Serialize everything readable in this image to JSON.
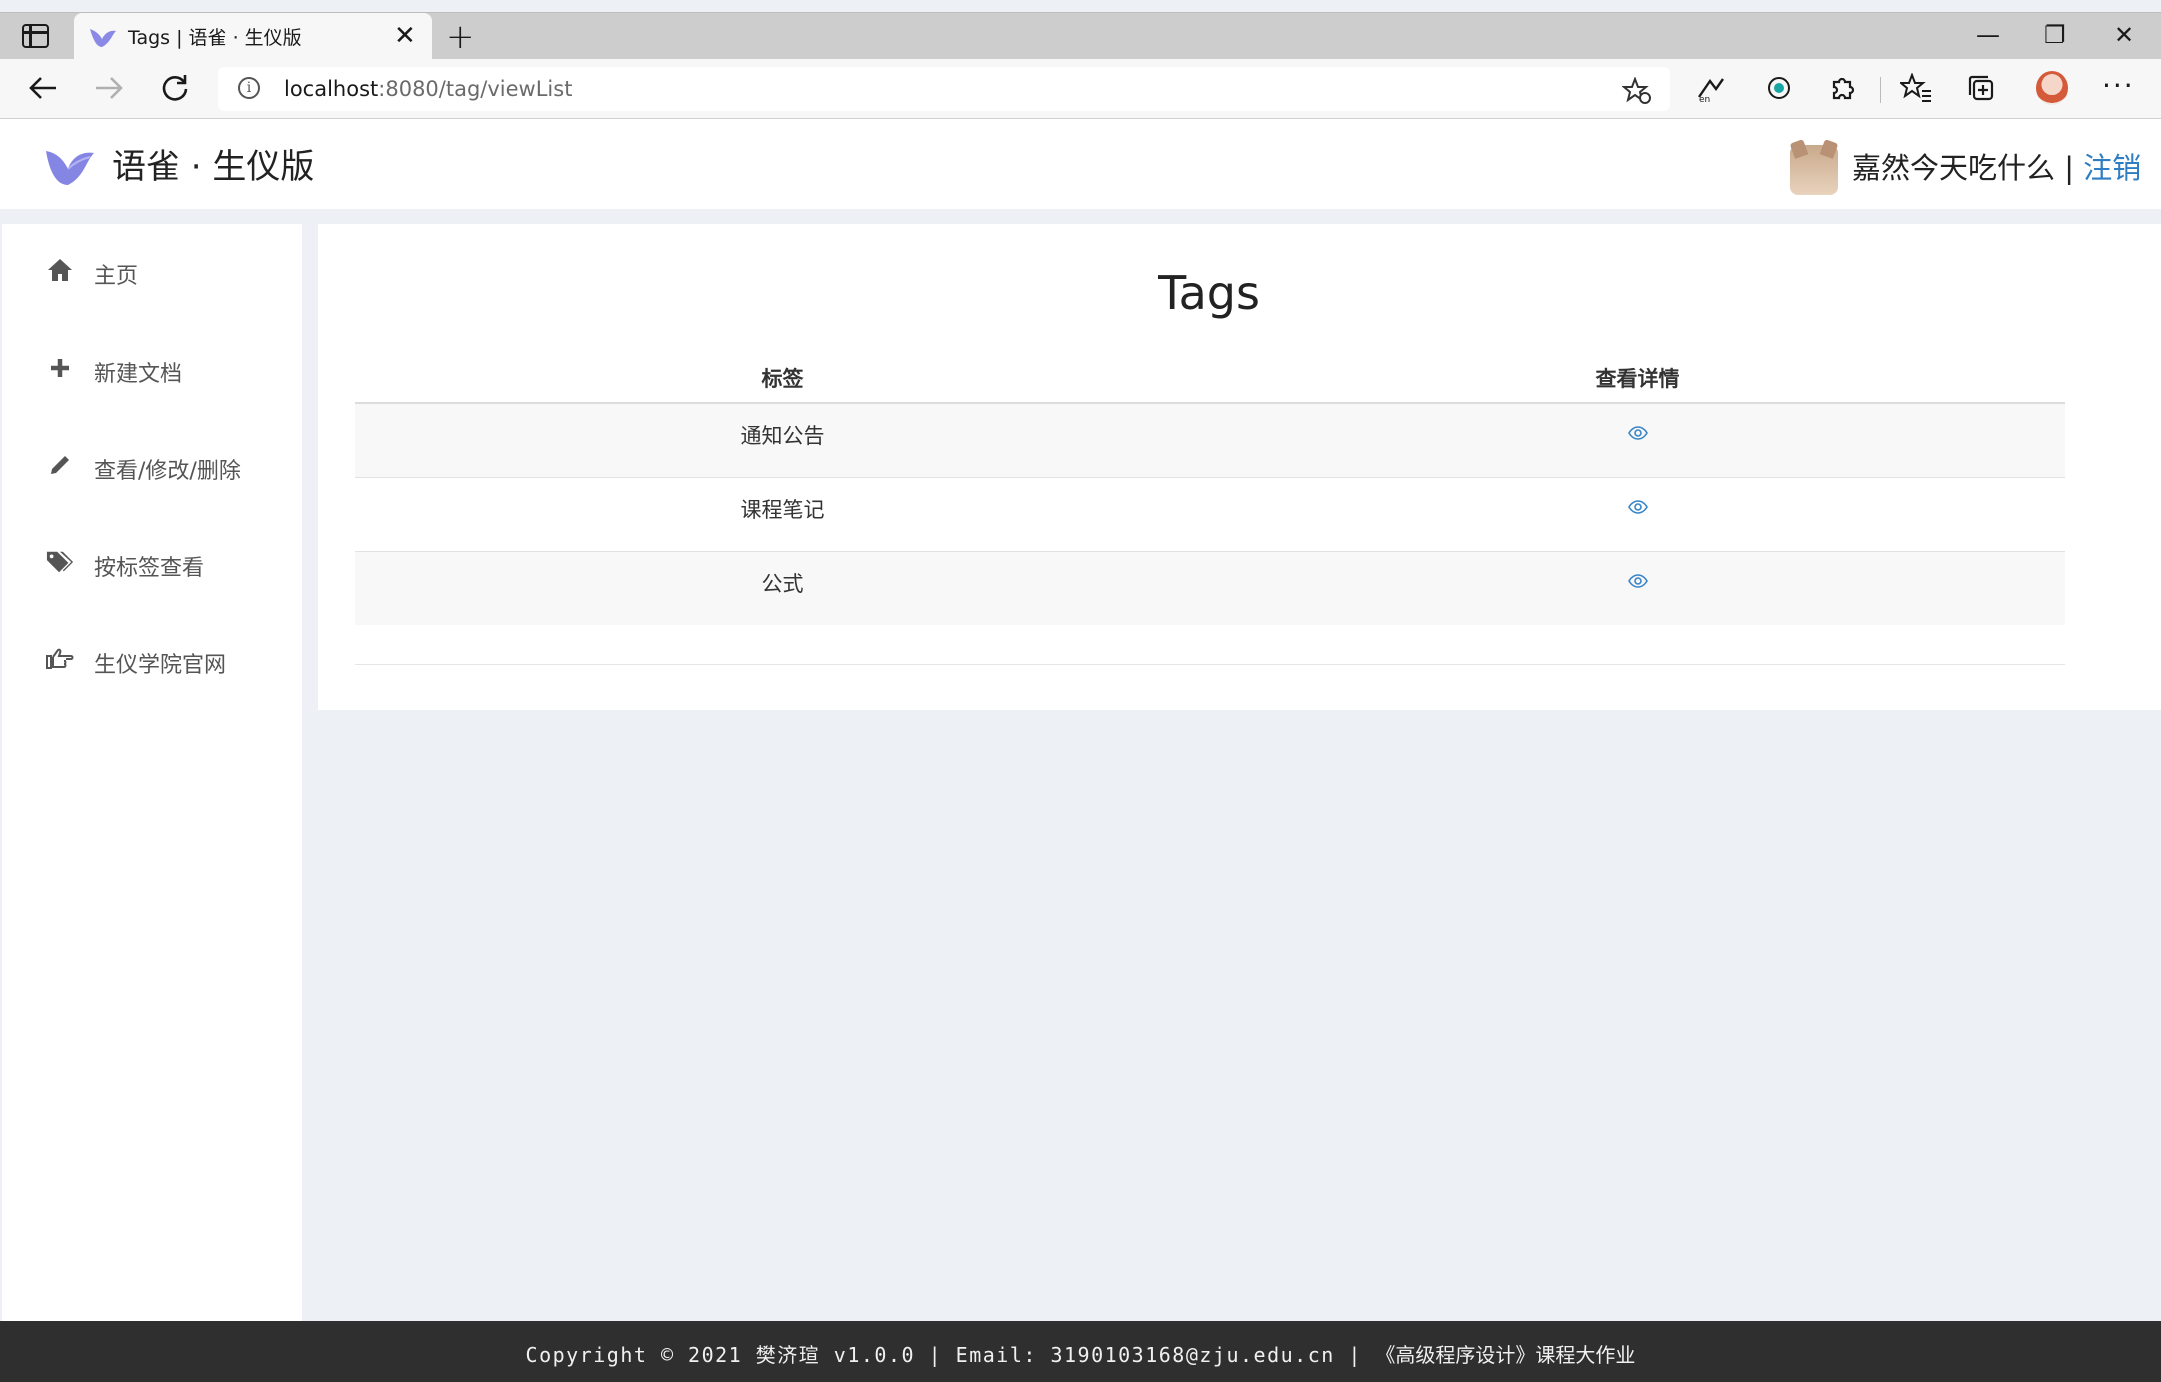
{
  "browser": {
    "tab_title": "Tags | 语雀 · 生仪版",
    "close_glyph": "✕",
    "newtab_glyph": "+",
    "url_host": "localhost",
    "url_path": ":8080/tag/viewList",
    "info_glyph": "i",
    "window_controls": {
      "minimize": "—",
      "restore": "❐",
      "close": "✕"
    }
  },
  "header": {
    "brand": "语雀 · 生仪版",
    "username": "嘉然今天吃什么",
    "separator": " | ",
    "logout": "注销"
  },
  "sidebar": {
    "items": [
      {
        "label": "主页",
        "icon": "home-icon"
      },
      {
        "label": "新建文档",
        "icon": "plus-icon"
      },
      {
        "label": "查看/修改/删除",
        "icon": "pencil-icon"
      },
      {
        "label": "按标签查看",
        "icon": "tags-icon"
      },
      {
        "label": "生仪学院官网",
        "icon": "hand-point-icon"
      }
    ]
  },
  "main": {
    "title": "Tags",
    "columns": [
      "标签",
      "查看详情"
    ],
    "rows": [
      {
        "tag": "通知公告",
        "action_icon": "eye-icon"
      },
      {
        "tag": "课程笔记",
        "action_icon": "eye-icon"
      },
      {
        "tag": "公式",
        "action_icon": "eye-icon"
      }
    ]
  },
  "footer": {
    "text_en": "Copyright © 2021 樊济瑄 v1.0.0 | Email: 3190103168@zju.edu.cn | ",
    "text_cn": "《高级程序设计》课程大作业"
  },
  "colors": {
    "link": "#2f7dc2",
    "page_bg": "#edf0f4",
    "footer_bg": "#2f2f2f",
    "brand_bird": "#7b7be0"
  }
}
